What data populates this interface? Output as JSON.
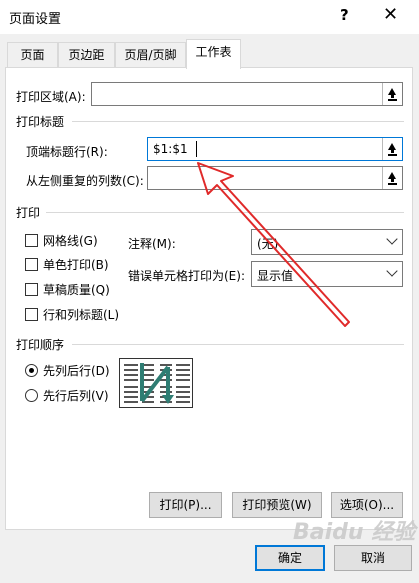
{
  "window": {
    "title": "页面设置",
    "help_glyph": "?",
    "close_glyph": "✕"
  },
  "tabs": [
    {
      "label": "页面"
    },
    {
      "label": "页边距"
    },
    {
      "label": "页眉/页脚"
    },
    {
      "label": "工作表",
      "active": true
    }
  ],
  "print_area": {
    "label": "打印区域(A):",
    "value": ""
  },
  "print_titles": {
    "section_label": "打印标题",
    "rows_repeat": {
      "label": "顶端标题行(R):",
      "value": "$1:$1"
    },
    "cols_repeat": {
      "label": "从左侧重复的列数(C):",
      "value": ""
    }
  },
  "print": {
    "section_label": "打印",
    "checkboxes": [
      {
        "label": "网格线(G)",
        "checked": false
      },
      {
        "label": "单色打印(B)",
        "checked": false
      },
      {
        "label": "草稿质量(Q)",
        "checked": false
      },
      {
        "label": "行和列标题(L)",
        "checked": false
      }
    ],
    "comments": {
      "label": "注释(M):",
      "value": "(无)"
    },
    "cell_errors": {
      "label": "错误单元格打印为(E):",
      "value": "显示值"
    }
  },
  "page_order": {
    "section_label": "打印顺序",
    "options": [
      {
        "label": "先列后行(D)",
        "selected": true
      },
      {
        "label": "先行后列(V)",
        "selected": false
      }
    ]
  },
  "buttons": {
    "print": "打印(P)...",
    "print_preview": "打印预览(W)",
    "options": "选项(O)...",
    "ok": "确定",
    "cancel": "取消"
  },
  "annotation": {
    "color": "#e02a2a"
  },
  "watermark": "Baidu 经验",
  "colors": {
    "focus": "#0078d7",
    "arrow_teal": "#2e7d73"
  }
}
